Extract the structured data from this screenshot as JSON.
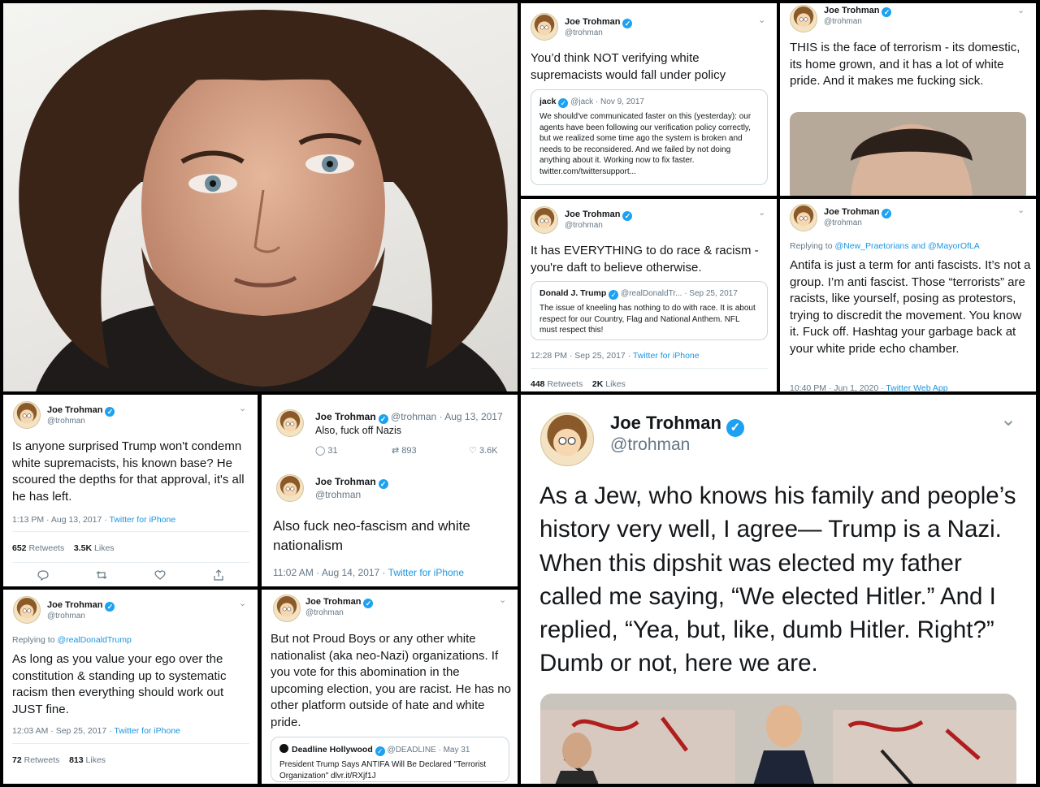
{
  "colors": {
    "accent": "#1da1f2",
    "text": "#14171a",
    "muted": "#657786",
    "border": "#e6ecf0",
    "background": "#000000"
  },
  "icons": {
    "verified": "verified-badge-icon",
    "chevron": "chevron-down-icon",
    "reply": "reply-icon",
    "retweet": "retweet-icon",
    "like": "heart-icon",
    "share": "share-icon"
  },
  "author": {
    "name": "Joe Trohman",
    "handle": "@trohman"
  },
  "t1": {
    "text": "You’d think NOT verifying white supremacists would fall under policy",
    "quote": {
      "name": "jack",
      "meta": "@jack · Nov 9, 2017",
      "text": "We should've communicated faster on this (yesterday): our agents have been following our verification policy correctly, but we realized some time ago the system is broken and needs to be reconsidered. And we failed by not doing anything about it. Working now to fix faster. twitter.com/twittersupport..."
    }
  },
  "t2": {
    "text": "THIS is the face of terrorism - its domestic, its home grown, and it has a lot of white pride. And it makes me fucking sick."
  },
  "t3": {
    "text": "It has EVERYTHING to do race & racism - you're daft to believe otherwise.",
    "quote": {
      "name": "Donald J. Trump",
      "meta": "@realDonaldTr... · Sep 25, 2017",
      "text": "The issue of kneeling has nothing to do with race. It is about respect for our Country, Flag and National Anthem. NFL must respect this!"
    },
    "time": "12:28 PM · Sep 25, 2017 · ",
    "source": "Twitter for iPhone",
    "rt": "448",
    "rt_label": "Retweets",
    "likes": "2K",
    "likes_label": "Likes"
  },
  "t4": {
    "replying": "Replying to ",
    "replying_to": "@New_Praetorians and @MayorOfLA",
    "text": "Antifa is just a term for anti fascists. It’s not a group. I’m anti fascist. Those “terrorists” are racists, like yourself, posing as protestors, trying to discredit the movement. You know it. Fuck off. Hashtag your garbage back at your white pride echo chamber.",
    "time": "10:40 PM · Jun 1, 2020 · ",
    "source": "Twitter Web App"
  },
  "t5": {
    "text": "Is anyone surprised Trump won't condemn white supremacists, his known base? He scoured the depths for that approval, it's all he has left.",
    "time": "1:13 PM · Aug 13, 2017 · ",
    "source": "Twitter for iPhone",
    "rt": "652",
    "rt_label": "Retweets",
    "likes": "3.5K",
    "likes_label": "Likes"
  },
  "t6": {
    "meta": "@trohman · Aug 13, 2017",
    "text": "Also, fuck off Nazis",
    "replies": "31",
    "retweets": "893",
    "likes": "3.6K"
  },
  "t7": {
    "text": "Also fuck neo-fascism and white nationalism",
    "time": "11:02 AM · Aug 14, 2017 · ",
    "source": "Twitter for iPhone"
  },
  "t8": {
    "replying": "Replying to ",
    "replying_to": "@realDonaldTrump",
    "text": "As long as you value your ego over the constitution & standing up to systematic racism then everything should work out JUST fine.",
    "time": "12:03 AM · Sep 25, 2017 · ",
    "source": "Twitter for iPhone",
    "rt": "72",
    "rt_label": "Retweets",
    "likes": "813",
    "likes_label": "Likes"
  },
  "t9": {
    "text": "But not Proud Boys or any other white nationalist (aka neo-Nazi) organizations. If you vote for this abomination in the upcoming election, you are racist. He has no other platform outside of hate and white pride.",
    "quote": {
      "name": "Deadline Hollywood",
      "meta": "@DEADLINE · May 31",
      "text": "President Trump Says ANTIFA Will Be Declared \"Terrorist Organization\" dlvr.it/RXjf1J"
    }
  },
  "t10": {
    "text": "As a Jew, who knows his family and people’s history very well, I agree— Trump is a Nazi. When this dipshit was elected my father called me saying, “We elected Hitler.” And I replied, “Yea, but, like, dumb Hitler. Right?” Dumb or not, here we are."
  }
}
